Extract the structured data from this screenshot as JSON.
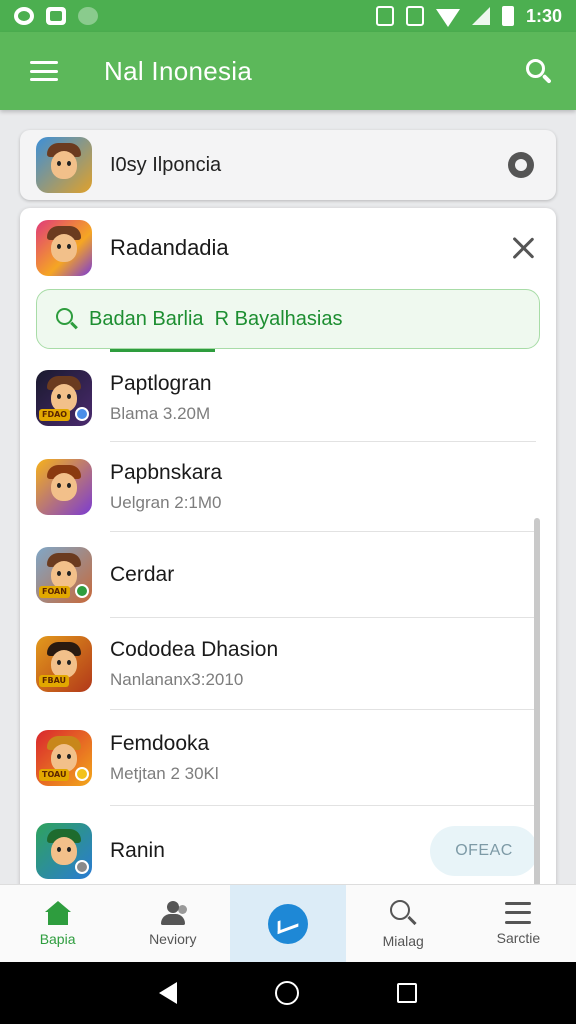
{
  "status_bar": {
    "time": "1:30"
  },
  "app_bar": {
    "title": "Nal Inonesia",
    "search_icon": "search-icon",
    "menu_icon": "menu-icon"
  },
  "top_card": {
    "label": "I0sy Ilponcia",
    "icon": "app-icon"
  },
  "panel": {
    "title": "Radandadia",
    "search": {
      "value": "Badan Barlia  R Bayalhasias",
      "placeholder": ""
    },
    "items": [
      {
        "name": "Paptlogran",
        "subtitle": "Blama 3.20M",
        "icon_colors": [
          "#1a1a2e",
          "#4a2a6e"
        ],
        "tag": "FDAO"
      },
      {
        "name": "Papbnskara",
        "subtitle": "Uelgran 2:1M0",
        "icon_colors": [
          "#f6b21b",
          "#7b3bd2"
        ],
        "tag": ""
      },
      {
        "name": "Cerdar",
        "subtitle": "",
        "icon_colors": [
          "#7fa7c8",
          "#c7693a"
        ],
        "tag": "FOAN"
      },
      {
        "name": "Cododea Dhasion",
        "subtitle": "Nanlananx3:2010",
        "icon_colors": [
          "#e39a1c",
          "#b2381a"
        ],
        "tag": "FBAU"
      },
      {
        "name": "Femdooka",
        "subtitle": "Metjtan 2 30Kl",
        "icon_colors": [
          "#d9262e",
          "#f3a81a"
        ],
        "tag": "TOAU"
      },
      {
        "name": "Ranin",
        "subtitle": "",
        "icon_colors": [
          "#2fa35c",
          "#2a7bd4"
        ],
        "tag": "",
        "action": "OFEAC"
      }
    ]
  },
  "bottom_nav": [
    {
      "label": "Bapia",
      "icon": "home-icon"
    },
    {
      "label": "Neviory",
      "icon": "people-icon"
    },
    {
      "label": "",
      "icon": "center-app-icon"
    },
    {
      "label": "Mialag",
      "icon": "search-icon"
    },
    {
      "label": "Sarctie",
      "icon": "menu-lines-icon"
    }
  ],
  "colors": {
    "primary": "#5cb85a",
    "accent_green": "#2e9d3e",
    "blue": "#1e88d6"
  }
}
